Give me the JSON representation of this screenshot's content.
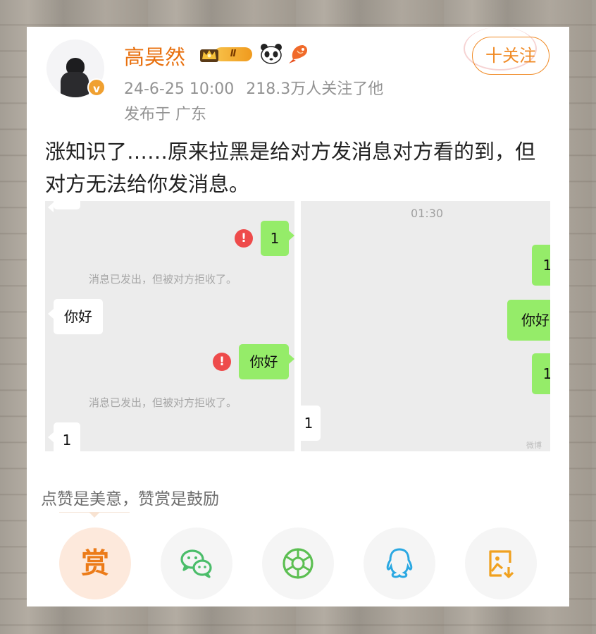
{
  "post": {
    "username": "高昊然",
    "level_badge": "Ⅱ",
    "verified_badge": "v",
    "date_time": "24-6-25 10:00",
    "followers_text": "218.3万人关注了他",
    "location_text": "发布于 广东",
    "follow_label": "十关注",
    "body_text": "涨知识了……原来拉黑是给对方发消息对方看的到，但对方无法给你发消息。"
  },
  "left_screenshot": {
    "top_msg": "",
    "msg1": "1",
    "error_icon": "!",
    "sys_notice_1": "消息已发出，但被对方拒收了。",
    "incoming_hello": "你好",
    "msg2": "你好",
    "sys_notice_2": "消息已发出，但被对方拒收了。",
    "incoming_one": "1"
  },
  "right_screenshot": {
    "time": "01:30",
    "msg1": "1",
    "msg2": "你好",
    "msg3": "1",
    "incoming_one": "1",
    "watermark": "微博"
  },
  "reward": {
    "prompt": "点赞是美意，赞赏是鼓励",
    "reward_label": "赏"
  },
  "share_icons": [
    "wechat-icon",
    "moments-icon",
    "qq-icon",
    "save-image-icon"
  ],
  "colors": {
    "accent_orange": "#e8700e",
    "wechat_green": "#95ec69",
    "error_red": "#ee4b4b"
  }
}
